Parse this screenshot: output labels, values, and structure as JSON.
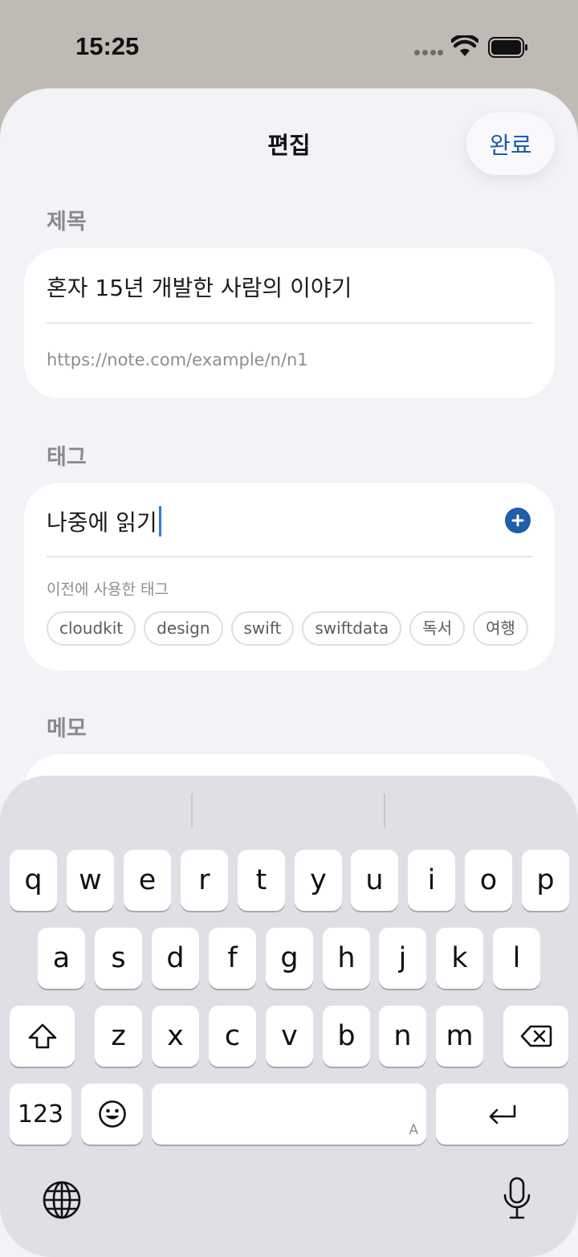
{
  "status_bar": {
    "time": "15:25"
  },
  "header": {
    "title": "편집",
    "done_label": "완료"
  },
  "sections": {
    "title_label": "제목",
    "tags_label": "태그",
    "memo_label": "메모"
  },
  "title_card": {
    "title_value": "혼자 15년 개발한 사람의 이야기",
    "url": "https://note.com/example/n/n1"
  },
  "tags_card": {
    "input_value": "나중에 읽기",
    "previous_label": "이전에 사용한 태그",
    "chips": [
      "cloudkit",
      "design",
      "swift",
      "swiftdata",
      "독서",
      "여행"
    ]
  },
  "keyboard": {
    "row1": [
      "q",
      "w",
      "e",
      "r",
      "t",
      "y",
      "u",
      "i",
      "o",
      "p"
    ],
    "row2": [
      "a",
      "s",
      "d",
      "f",
      "g",
      "h",
      "j",
      "k",
      "l"
    ],
    "row3": [
      "z",
      "x",
      "c",
      "v",
      "b",
      "n",
      "m"
    ],
    "numbers_label": "123",
    "space_mark": "A"
  },
  "icons": {
    "signal": "signal-dots-icon",
    "wifi": "wifi-icon",
    "battery": "battery-icon",
    "add": "plus-circle-icon",
    "shift": "shift-icon",
    "delete": "delete-icon",
    "emoji": "emoji-icon",
    "return": "return-icon",
    "globe": "globe-icon",
    "mic": "microphone-icon"
  },
  "colors": {
    "accent": "#1f5ea8",
    "caret": "#2b7be4"
  }
}
